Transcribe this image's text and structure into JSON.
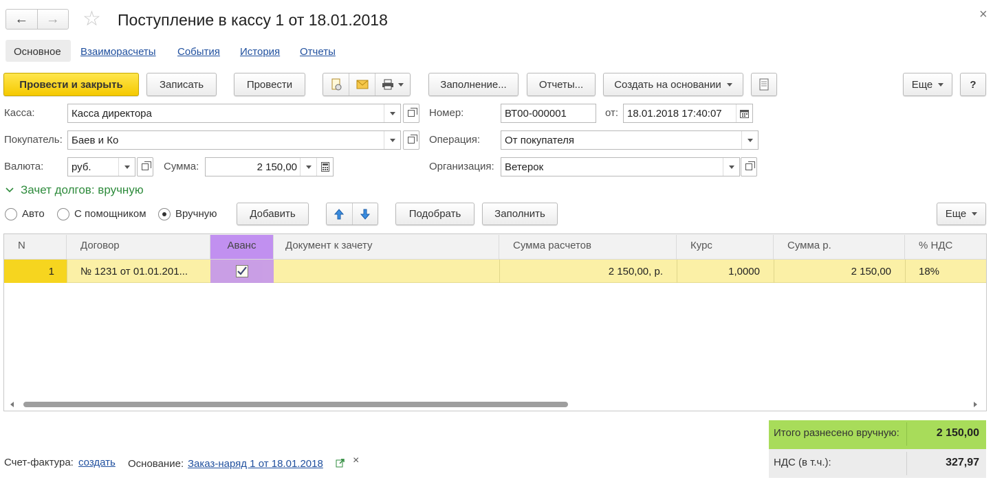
{
  "window": {
    "title": "Поступление в кассу 1 от 18.01.2018"
  },
  "tabs": [
    "Основное",
    "Взаиморасчеты",
    "События",
    "История",
    "Отчеты"
  ],
  "toolbar": {
    "post_close": "Провести и закрыть",
    "save": "Записать",
    "post": "Провести",
    "fill": "Заполнение...",
    "reports": "Отчеты...",
    "create_based": "Создать на основании",
    "more": "Еще",
    "help": "?"
  },
  "form": {
    "kassa_label": "Касса:",
    "kassa_value": "Касса директора",
    "buyer_label": "Покупатель:",
    "buyer_value": "Баев и Ко",
    "currency_label": "Валюта:",
    "currency_value": "руб.",
    "sum_label": "Сумма:",
    "sum_value": "2 150,00",
    "number_label": "Номер:",
    "number_value": "ВТ00-000001",
    "date_label": "от:",
    "date_value": "18.01.2018 17:40:07",
    "operation_label": "Операция:",
    "operation_value": "От покупателя",
    "org_label": "Организация:",
    "org_value": "Ветерок"
  },
  "debt_section": {
    "title": "Зачет долгов: вручную",
    "mode_auto": "Авто",
    "mode_helper": "С помощником",
    "mode_manual": "Вручную",
    "add": "Добавить",
    "select": "Подобрать",
    "fill": "Заполнить",
    "more": "Еще"
  },
  "table": {
    "columns": [
      "N",
      "Договор",
      "Аванс",
      "Документ к зачету",
      "Сумма расчетов",
      "Курс",
      "Сумма р.",
      "% НДС"
    ],
    "rows": [
      {
        "n": "1",
        "contract": "№ 1231 от 01.01.201...",
        "advance": true,
        "doc": "",
        "sum": "2 150,00, р.",
        "rate": "1,0000",
        "sum_r": "2 150,00",
        "vat": "18%"
      }
    ]
  },
  "totals": {
    "manual_label": "Итого разнесено вручную:",
    "manual_value": "2 150,00",
    "vat_label": "НДС (в т.ч.):",
    "vat_value": "327,97"
  },
  "footer": {
    "invoice_label": "Счет-фактура:",
    "invoice_link": "создать",
    "basis_label": "Основание:",
    "basis_link": "Заказ-наряд 1 от 18.01.2018"
  },
  "colors": {
    "accent_yellow": "#f5c900",
    "row_highlight": "#fbf0a6",
    "advance_col": "#c190f0",
    "totals_green": "#a8dc5a",
    "link": "#1f4f9e",
    "section_green": "#2e8b3c"
  }
}
